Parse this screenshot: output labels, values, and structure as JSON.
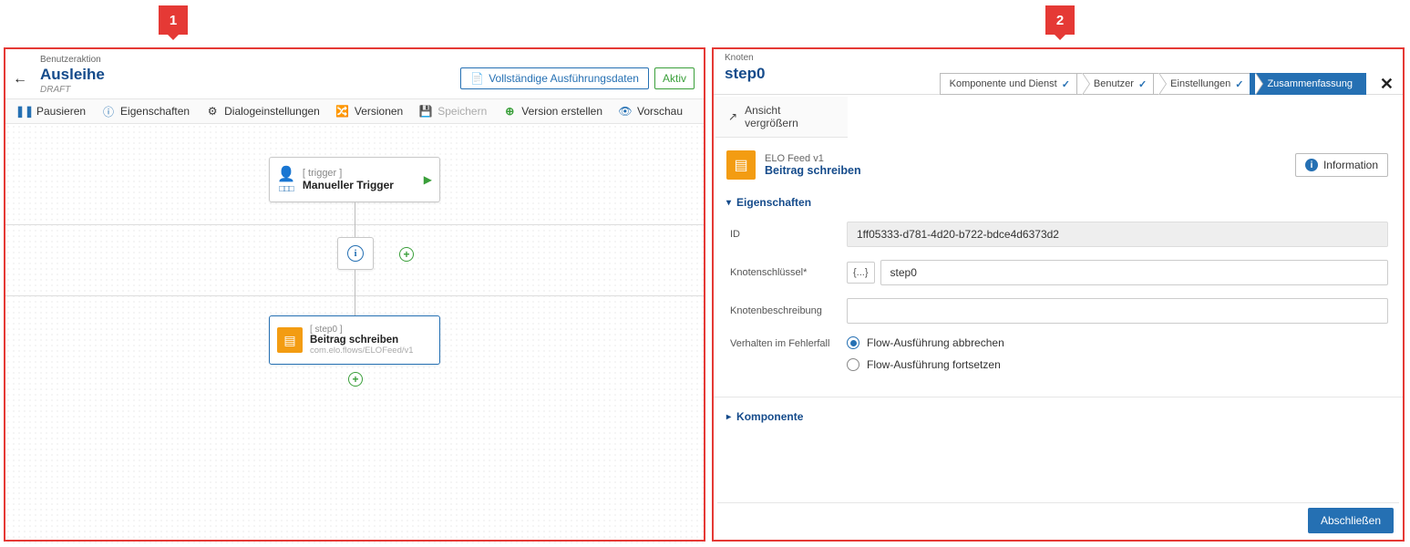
{
  "callouts": {
    "one": "1",
    "two": "2"
  },
  "left": {
    "type_label": "Benutzeraktion",
    "title": "Ausleihe",
    "draft": "DRAFT",
    "btn_full_exec": "Vollständige Ausführungsdaten",
    "btn_active": "Aktiv",
    "toolbar": {
      "pause": "Pausieren",
      "properties": "Eigenschaften",
      "dialog": "Dialogeinstellungen",
      "versions": "Versionen",
      "save": "Speichern",
      "create_version": "Version erstellen",
      "preview": "Vorschau"
    },
    "nodes": {
      "trigger_bracket": "[ trigger ]",
      "trigger_name": "Manueller Trigger",
      "step_bracket": "[ step0 ]",
      "step_name": "Beitrag schreiben",
      "step_sub": "com.elo.flows/ELOFeed/v1"
    }
  },
  "right": {
    "type_label": "Knoten",
    "title": "step0",
    "wizard": {
      "s1": "Komponente und Dienst",
      "s2": "Benutzer",
      "s3": "Einstellungen",
      "s4": "Zusammenfassung"
    },
    "expand": "Ansicht vergrößern",
    "feed_version": "ELO Feed  v1",
    "feed_title": "Beitrag schreiben",
    "btn_information": "Information",
    "section_props": "Eigenschaften",
    "form": {
      "id_label": "ID",
      "id_value": "1ff05333-d781-4d20-b722-bdce4d6373d2",
      "key_label": "Knotenschlüssel*",
      "key_pre": "{...}",
      "key_value": "step0",
      "desc_label": "Knotenbeschreibung",
      "desc_value": "",
      "err_label": "Verhalten im Fehlerfall",
      "err_opt1": "Flow-Ausführung abbrechen",
      "err_opt2": "Flow-Ausführung fortsetzen"
    },
    "section_comp": "Komponente",
    "btn_submit": "Abschließen"
  }
}
